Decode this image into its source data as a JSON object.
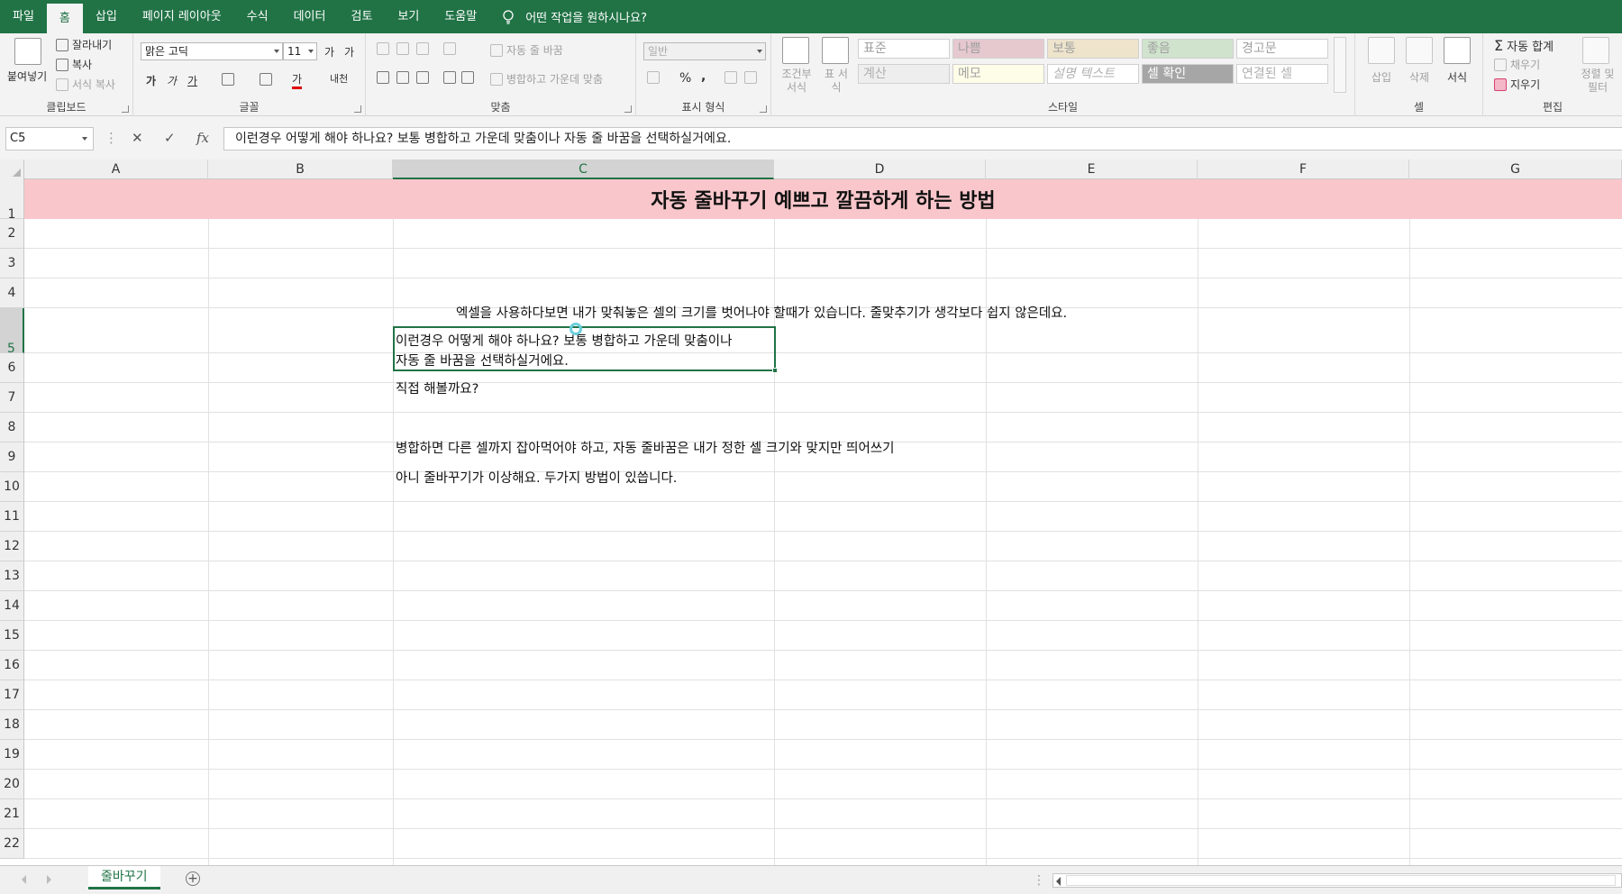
{
  "tabs": [
    "파일",
    "홈",
    "삽입",
    "페이지 레이아웃",
    "수식",
    "데이터",
    "검토",
    "보기",
    "도움말"
  ],
  "active_tab_index": 1,
  "tell_me": "어떤 작업을 원하시나요?",
  "ribbon": {
    "clipboard": {
      "label": "클립보드",
      "paste": "붙여넣기",
      "cut": "잘라내기",
      "copy": "복사",
      "format_painter": "서식 복사"
    },
    "font": {
      "label": "글꼴",
      "name": "맑은 고딕",
      "size": "11",
      "grow": "가",
      "shrink": "가",
      "bold": "가",
      "italic": "가",
      "underline": "가",
      "font_color": "가",
      "phonetic": "내천"
    },
    "alignment": {
      "label": "맞춤",
      "wrap_text": "자동 줄 바꿈",
      "merge_center": "병합하고 가운데 맞춤"
    },
    "number": {
      "label": "표시 형식",
      "format": "일반",
      "percent": "%",
      "comma": ","
    },
    "styles": {
      "label": "스타일",
      "conditional": "조건부 서식",
      "table": "표 서식",
      "cells": [
        {
          "name": "표준",
          "bg": "#ffffff",
          "fg": "#a0a0a0"
        },
        {
          "name": "나쁨",
          "bg": "#e6c8cf",
          "fg": "#a0a0a0"
        },
        {
          "name": "보통",
          "bg": "#eee4cc",
          "fg": "#a0a0a0"
        },
        {
          "name": "좋음",
          "bg": "#d0e3cd",
          "fg": "#a0a0a0"
        },
        {
          "name": "경고문",
          "bg": "#ffffff",
          "fg": "#a0a0a0"
        },
        {
          "name": "계산",
          "bg": "#eeeeee",
          "fg": "#b0b0b0"
        },
        {
          "name": "메모",
          "bg": "#fdfde8",
          "fg": "#a0a0a0"
        },
        {
          "name": "설명 텍스트",
          "bg": "#ffffff",
          "fg": "#b0b0b0"
        },
        {
          "name": "셀 확인",
          "bg": "#a6a6a6",
          "fg": "#ffffff"
        },
        {
          "name": "연결된 셀",
          "bg": "#ffffff",
          "fg": "#b0b0b0"
        }
      ]
    },
    "cells": {
      "label": "셀",
      "insert": "삽입",
      "delete": "삭제",
      "format": "서식"
    },
    "editing": {
      "label": "편집",
      "autosum": "자동 합계",
      "fill": "채우기",
      "clear": "지우기",
      "sort_filter": "정렬 및 필터"
    }
  },
  "formula_bar": {
    "name_box": "C5",
    "cancel": "✕",
    "enter": "✓",
    "fx": "fx",
    "content": "이런경우 어떻게 해야 하나요? 보통 병합하고 가운데 맞춤이나 자동 줄 바꿈을 선택하실거에요."
  },
  "grid": {
    "columns": [
      "A",
      "B",
      "C",
      "D",
      "E",
      "F",
      "G"
    ],
    "selected_column": "C",
    "rows": [
      "1",
      "2",
      "3",
      "4",
      "5",
      "6",
      "7",
      "8",
      "9",
      "10",
      "11",
      "12",
      "13",
      "14",
      "15",
      "16",
      "17",
      "18",
      "19",
      "20",
      "21",
      "22"
    ],
    "selected_row": "5",
    "title": "자동 줄바꾸기 예쁘고 깔끔하게 하는 방법",
    "title_bg": "#f9c7cb",
    "cells": {
      "r4": "엑셀을 사용하다보면 내가 맞춰놓은 셀의 크기를 벗어나야 할때가 있습니다. 줄맞추기가 생각보다 쉽지 않은데요.",
      "r5_line1": "이런경우 어떻게 해야 하나요? 보통 병합하고 가운데 맞춤이나",
      "r5_line2": "자동 줄 바꿈을 선택하실거에요.",
      "r6": "직접 해볼까요?",
      "r8": "병합하면 다른 셀까지 잡아먹어야 하고, 자동 줄바꿈은 내가 정한 셀 크기와 맞지만 띄어쓰기",
      "r9": "아니 줄바꾸기가 이상해요. 두가지 방법이 있씁니다."
    }
  },
  "sheet": {
    "name": "줄바꾸기",
    "add": "+"
  },
  "accent": "#217346"
}
